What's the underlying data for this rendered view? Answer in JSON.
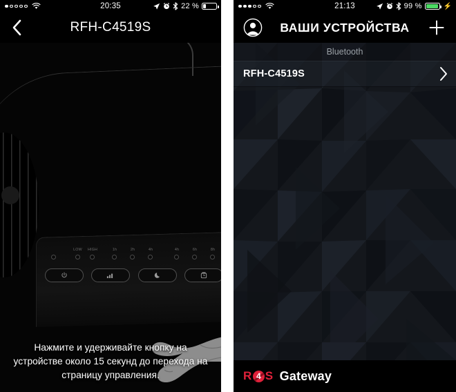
{
  "left_phone": {
    "status_bar": {
      "signal_dots_total": 5,
      "signal_dots_filled": 1,
      "wifi_icon": "wifi-icon",
      "time": "20:35",
      "location_icon": "location-arrow-icon",
      "alarm_icon": "alarm-clock-icon",
      "bluetooth_icon": "bluetooth-icon",
      "battery_percent": "22 %",
      "battery_level": 22,
      "battery_charging": false,
      "battery_color": "#ffffff"
    },
    "navbar": {
      "back_icon": "chevron-left-icon",
      "title": "RFH-C4519S"
    },
    "device_panel": {
      "led_labels_left": [
        "",
        "LOW",
        "HIGH"
      ],
      "led_group_1": [
        "1h",
        "2h",
        "4h"
      ],
      "led_group_2": [
        "4h",
        "6h",
        "8h"
      ],
      "buttons": [
        {
          "name": "power-button",
          "icon": "power-icon"
        },
        {
          "name": "fan-speed-button",
          "icon": "signal-bars-icon"
        },
        {
          "name": "night-mode-button",
          "icon": "moon-icon"
        },
        {
          "name": "timer-button",
          "icon": "timer-icon"
        }
      ]
    },
    "instruction": "Нажмите и удерживайте кнопку на устройстве около 15 секунд до перехода на страницу управления."
  },
  "right_phone": {
    "status_bar": {
      "signal_dots_total": 5,
      "signal_dots_filled": 3,
      "wifi_icon": "wifi-icon",
      "time": "21:13",
      "location_icon": "location-arrow-icon",
      "alarm_icon": "alarm-clock-icon",
      "bluetooth_icon": "bluetooth-icon",
      "battery_percent": "99 %",
      "battery_level": 99,
      "battery_charging": true,
      "battery_color": "#4cd964"
    },
    "navbar": {
      "avatar_icon": "user-avatar-icon",
      "title": "ВАШИ УСТРОЙСТВА",
      "add_icon": "plus-icon"
    },
    "list": {
      "section_header": "Bluetooth",
      "rows": [
        {
          "name": "RFH-C4519S",
          "chevron": "chevron-right-icon"
        }
      ]
    },
    "footer": {
      "logo_prefix": "R",
      "logo_badge": "4",
      "logo_suffix": "S",
      "logo_word": "Gateway",
      "brand_color": "#e0213a"
    }
  }
}
